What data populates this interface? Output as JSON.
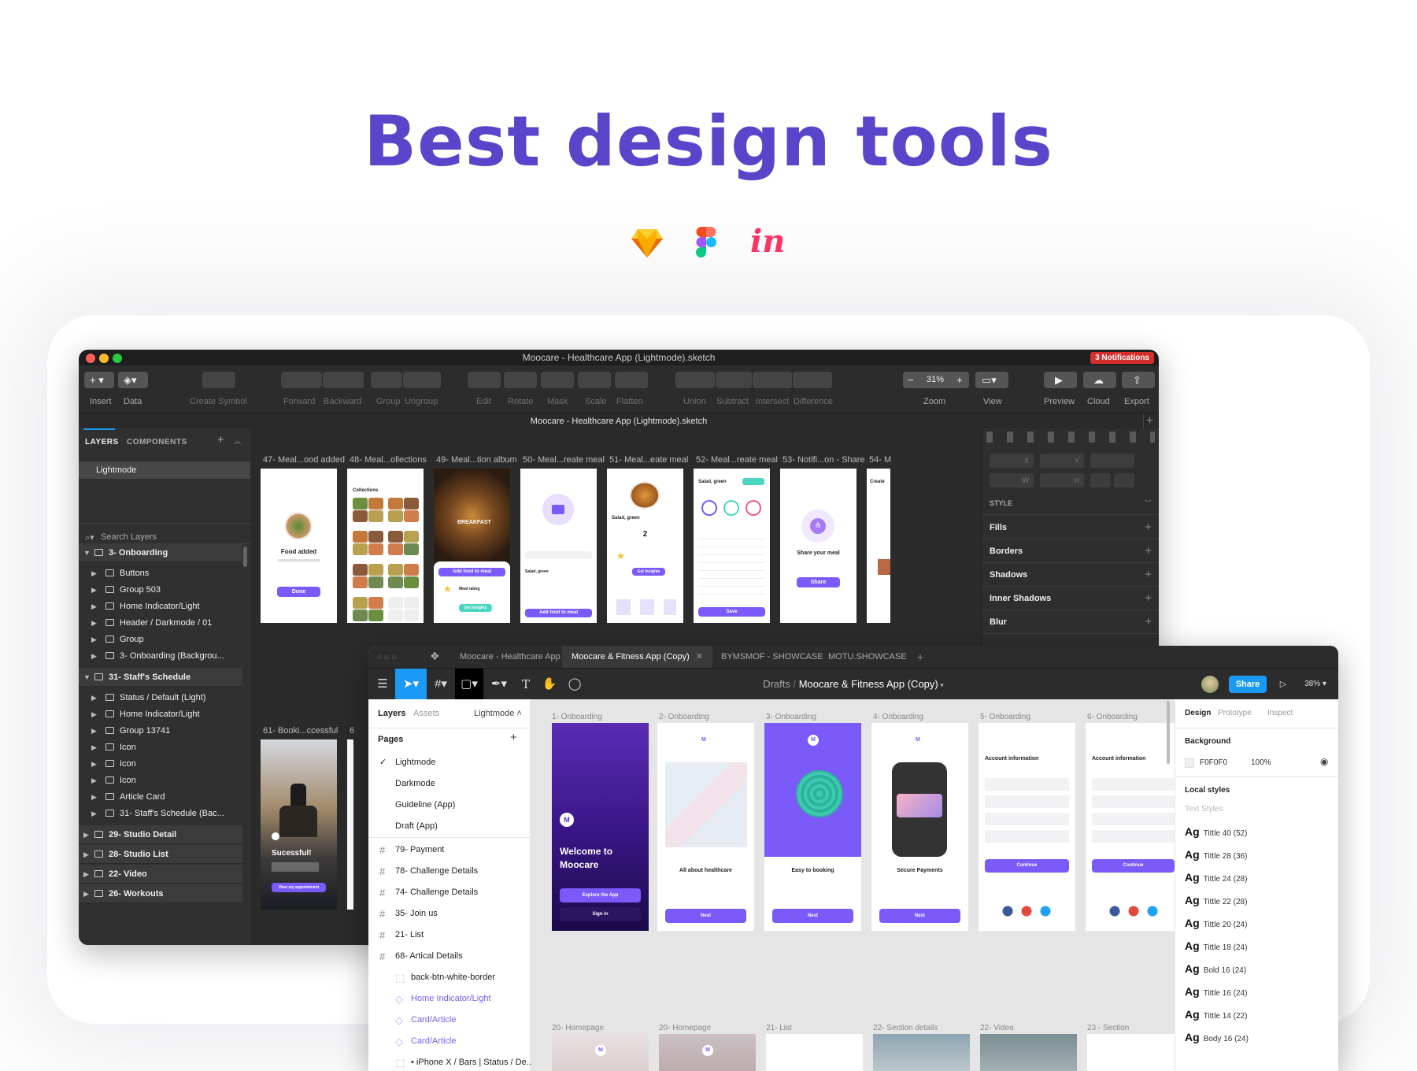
{
  "heading": "Best design tools",
  "icons": [
    "sketch-logo",
    "figma-logo",
    "invision-logo"
  ],
  "colors": {
    "brand_purple": "#5845c9",
    "screen_purple": "#7a5af8",
    "notification_red": "#d62d2d",
    "share_blue": "#1a9af5"
  },
  "sketch": {
    "window_title": "Moocare - Healthcare App (Lightmode).sketch",
    "notification": "3 Notifications",
    "document_tab": "Moocare - Healthcare App (Lightmode).sketch",
    "toolbar": {
      "insert": "Insert",
      "data": "Data",
      "create_symbol": "Create Symbol",
      "forward": "Forward",
      "backward": "Backward",
      "group": "Group",
      "ungroup": "Ungroup",
      "edit": "Edit",
      "rotate": "Rotate",
      "mask": "Mask",
      "scale": "Scale",
      "flatten": "Flatten",
      "union": "Union",
      "subtract": "Subtract",
      "intersect": "Intersect",
      "difference": "Difference",
      "zoom": "Zoom",
      "zoom_value": "31%",
      "view": "View",
      "preview": "Preview",
      "cloud": "Cloud",
      "export": "Export"
    },
    "sidebar": {
      "tab_layers": "LAYERS",
      "tab_components": "COMPONENTS",
      "page": "Lightmode",
      "search_placeholder": "Search Layers",
      "sections": [
        {
          "label": "3- Onboarding",
          "children": [
            "Buttons",
            "Group 503",
            "Home Indicator/Light",
            "Header / Darkmode / 01",
            "Group",
            "3- Onboarding (Backgrou..."
          ]
        },
        {
          "label": "31- Staff's Schedule",
          "children": [
            "Status / Default (Light)",
            "Home Indicator/Light",
            "Group 13741",
            "Icon",
            "Icon",
            "Icon",
            "Article Card",
            "31- Staff's Schedule  (Bac..."
          ]
        }
      ],
      "collapsed": [
        "29- Studio Detail",
        "28- Studio List",
        "22- Video",
        "26- Workouts"
      ]
    },
    "artboards": [
      "47- Meal...ood added",
      "48- Meal...ollections",
      "49- Meal...tion album",
      "50- Meal...reate meal",
      "51- Meal...eate meal",
      "52- Meal...reate meal",
      "53- Notifi...on - Share",
      "54- M"
    ],
    "artboard_bottom": [
      "61- Booki...ccessful",
      "6"
    ],
    "screen_text": {
      "food_added": "Food added",
      "done": "Done",
      "collections": "Collections",
      "breakfast": "BREAKFAST",
      "add_food": "Add food to meal",
      "meal_rating": "Meal rating",
      "get_insights": "Get Insights",
      "salad_green": "Salad, green",
      "quantity": "2",
      "save": "Save",
      "share_meal": "Share your meal",
      "share": "Share",
      "successful": "Sucessful!",
      "view_appointment": "View my appointment",
      "create": "Create"
    },
    "inspector": {
      "style": "STYLE",
      "rows": [
        "Fills",
        "Borders",
        "Shadows",
        "Inner Shadows",
        "Blur"
      ],
      "x": "X",
      "y": "Y",
      "w": "W",
      "h": "H"
    }
  },
  "figma": {
    "tabs": [
      "Moocare - Healthcare App",
      "Moocare & Fitness App (Copy)",
      "BYMSMOF - SHOWCASE",
      "MOTU.SHOWCASE"
    ],
    "breadcrumb_root": "Drafts",
    "breadcrumb_file": "Moocare & Fitness App (Copy)",
    "share": "Share",
    "zoom": "38%",
    "left": {
      "tab_layers": "Layers",
      "tab_assets": "Assets",
      "page_select": "Lightmode",
      "pages_label": "Pages",
      "pages": [
        "Lightmode",
        "Darkmode",
        "Guideline (App)",
        "Draft (App)"
      ],
      "layers": [
        {
          "t": "79- Payment",
          "k": "frame"
        },
        {
          "t": "78- Challenge Details",
          "k": "frame"
        },
        {
          "t": "74- Challenge Details",
          "k": "frame"
        },
        {
          "t": "35- Join us",
          "k": "frame"
        },
        {
          "t": "21- List",
          "k": "frame"
        },
        {
          "t": "68- Artical Details",
          "k": "frame"
        },
        {
          "t": "back-btn-white-border",
          "k": "child"
        },
        {
          "t": "Home Indicator/Light",
          "k": "comp"
        },
        {
          "t": "Card/Article",
          "k": "comp"
        },
        {
          "t": "Card/Article",
          "k": "comp"
        },
        {
          "t": "• iPhone X / Bars | Status / De...",
          "k": "child"
        }
      ]
    },
    "frames": [
      {
        "label": "1- Onboarding",
        "title": "Welcome to Moocare",
        "btn1": "Explore the App",
        "btn2": "Sign in"
      },
      {
        "label": "2- Onboarding",
        "title": "All about healthcare",
        "btn": "Next"
      },
      {
        "label": "3- Onboarding",
        "title": "Easy to booking",
        "btn": "Next"
      },
      {
        "label": "4- Onboarding",
        "title": "Secure Payments",
        "btn": "Next"
      },
      {
        "label": "5- Onboarding",
        "title": "Account information",
        "btn": "Continue"
      },
      {
        "label": "6- Onboarding",
        "title": "Account information",
        "btn": "Continue"
      }
    ],
    "bottom_frames": [
      "20- Homepage",
      "20- Homepage",
      "21- List",
      "22- Section details",
      "22- Video",
      "23 - Section"
    ],
    "right": {
      "tab_design": "Design",
      "tab_prototype": "Prototype",
      "tab_inspect": "Inspect",
      "background": "Background",
      "bg_hex": "F0F0F0",
      "bg_opacity": "100%",
      "local_styles": "Local styles",
      "text_styles": "Text Styles",
      "styles": [
        "Tittle 40 (52)",
        "Tittle 28 (36)",
        "Tittle 24 (28)",
        "Tittle 22 (28)",
        "Tittle 20 (24)",
        "Tittle 18 (24)",
        "Bold 16 (24)",
        "Tittle 16 (24)",
        "Tittle 14 (22)",
        "Body 16 (24)"
      ],
      "ag": "Ag"
    }
  }
}
